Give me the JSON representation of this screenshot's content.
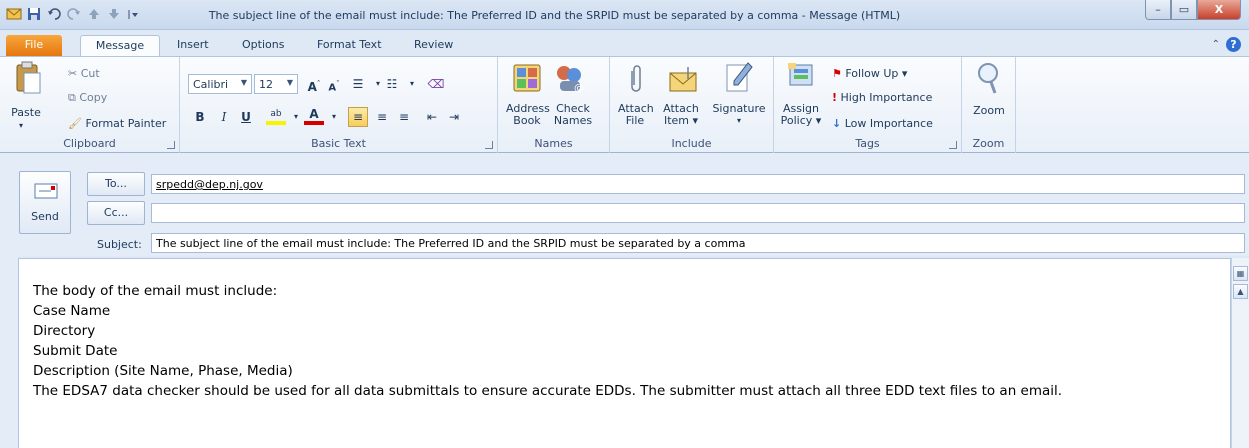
{
  "window": {
    "title": "The subject line of the email must include: The Preferred ID and the SRPID must be separated by a comma  -  Message (HTML)",
    "controls": {
      "minimize": "–",
      "maximize": "▭",
      "close": "X"
    }
  },
  "tabs": [
    "File",
    "Message",
    "Insert",
    "Options",
    "Format Text",
    "Review"
  ],
  "ribbon": {
    "clipboard": {
      "label": "Clipboard",
      "paste": "Paste",
      "cut": "Cut",
      "copy": "Copy",
      "format_painter": "Format Painter"
    },
    "basic_text": {
      "label": "Basic Text",
      "font": "Calibri",
      "size": "12"
    },
    "names": {
      "label": "Names",
      "address_book_1": "Address",
      "address_book_2": "Book",
      "check_names_1": "Check",
      "check_names_2": "Names"
    },
    "include": {
      "label": "Include",
      "attach_file_1": "Attach",
      "attach_file_2": "File",
      "attach_item_1": "Attach",
      "attach_item_2": "Item ▾",
      "signature": "Signature"
    },
    "tags": {
      "label": "Tags",
      "assign_policy_1": "Assign",
      "assign_policy_2": "Policy ▾",
      "follow_up": "Follow Up ▾",
      "high_importance": "High Importance",
      "low_importance": "Low Importance"
    },
    "zoom": {
      "label": "Zoom",
      "zoom": "Zoom"
    }
  },
  "compose": {
    "send": "Send",
    "to_button": "To...",
    "cc_button": "Cc...",
    "subject_label": "Subject:",
    "to_value": "srpedd@dep.nj.gov",
    "cc_value": "",
    "subject_value": "The subject line of the email must include: The Preferred ID and the SRPID must be separated by a comma"
  },
  "body": {
    "lines": [
      "The body of the email must include:",
      "Case Name",
      "Directory",
      "Submit Date",
      "Description (Site Name, Phase, Media)",
      "The EDSA7 data checker should be used for all data submittals to ensure accurate EDDs. The submitter must attach all three EDD text files to an email."
    ]
  }
}
